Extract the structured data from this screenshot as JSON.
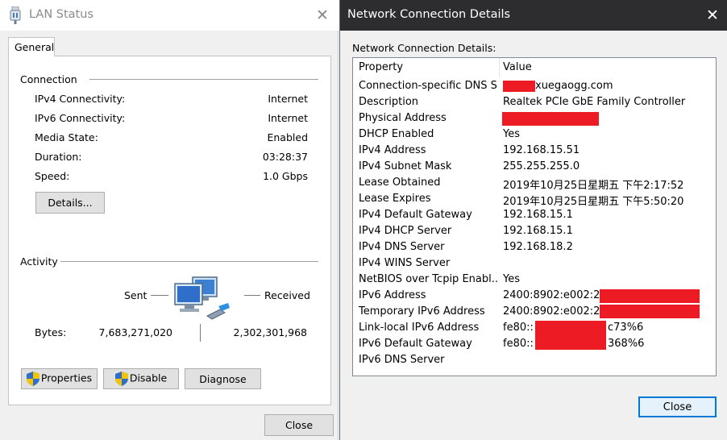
{
  "lan_status": {
    "title": "LAN Status",
    "close_glyph": "✕",
    "tab_general": "General",
    "connection": {
      "heading": "Connection",
      "rows": [
        {
          "label": "IPv4 Connectivity:",
          "value": "Internet"
        },
        {
          "label": "IPv6 Connectivity:",
          "value": "Internet"
        },
        {
          "label": "Media State:",
          "value": "Enabled"
        },
        {
          "label": "Duration:",
          "value": "03:28:37"
        },
        {
          "label": "Speed:",
          "value": "1.0 Gbps"
        }
      ],
      "details_button": "Details..."
    },
    "activity": {
      "heading": "Activity",
      "sent_label": "Sent",
      "received_label": "Received",
      "bytes_label": "Bytes:",
      "bytes_sent": "7,683,271,020",
      "bytes_received": "2,302,301,968"
    },
    "buttons": {
      "properties": "Properties",
      "disable": "Disable",
      "diagnose": "Diagnose",
      "close": "Close"
    }
  },
  "details_window": {
    "title": "Network Connection Details",
    "close_glyph": "✕",
    "subtitle": "Network Connection Details:",
    "columns": {
      "property": "Property",
      "value": "Value"
    },
    "rows": [
      {
        "property": "Connection-specific DNS S...",
        "value": "xuegaogg.com"
      },
      {
        "property": "Description",
        "value": "Realtek PCIe GbE Family Controller"
      },
      {
        "property": "Physical Address",
        "value": ""
      },
      {
        "property": "DHCP Enabled",
        "value": "Yes"
      },
      {
        "property": "IPv4 Address",
        "value": "192.168.15.51"
      },
      {
        "property": "IPv4 Subnet Mask",
        "value": "255.255.255.0"
      },
      {
        "property": "Lease Obtained",
        "value": "2019年10月25日星期五 下午2:17:52"
      },
      {
        "property": "Lease Expires",
        "value": "2019年10月25日星期五 下午5:50:20"
      },
      {
        "property": "IPv4 Default Gateway",
        "value": "192.168.15.1"
      },
      {
        "property": "IPv4 DHCP Server",
        "value": "192.168.15.1"
      },
      {
        "property": "IPv4 DNS Server",
        "value": "192.168.18.2"
      },
      {
        "property": "IPv4 WINS Server",
        "value": ""
      },
      {
        "property": "NetBIOS over Tcpip Enabl...",
        "value": "Yes"
      },
      {
        "property": "IPv6 Address",
        "value": "2400:8902:e002:2b"
      },
      {
        "property": "Temporary IPv6 Address",
        "value": "2400:8902:e002:2b"
      },
      {
        "property": "Link-local IPv6 Address",
        "value": "fe80::",
        "value_tail": "c73%6"
      },
      {
        "property": "IPv6 Default Gateway",
        "value": "fe80::",
        "value_tail": "368%6"
      },
      {
        "property": "IPv6 DNS Server",
        "value": ""
      }
    ],
    "close_button": "Close"
  },
  "colors": {
    "redaction": "#ed1c24",
    "dark_titlebar": "#2d2d30",
    "focus_border": "#0078d7"
  }
}
